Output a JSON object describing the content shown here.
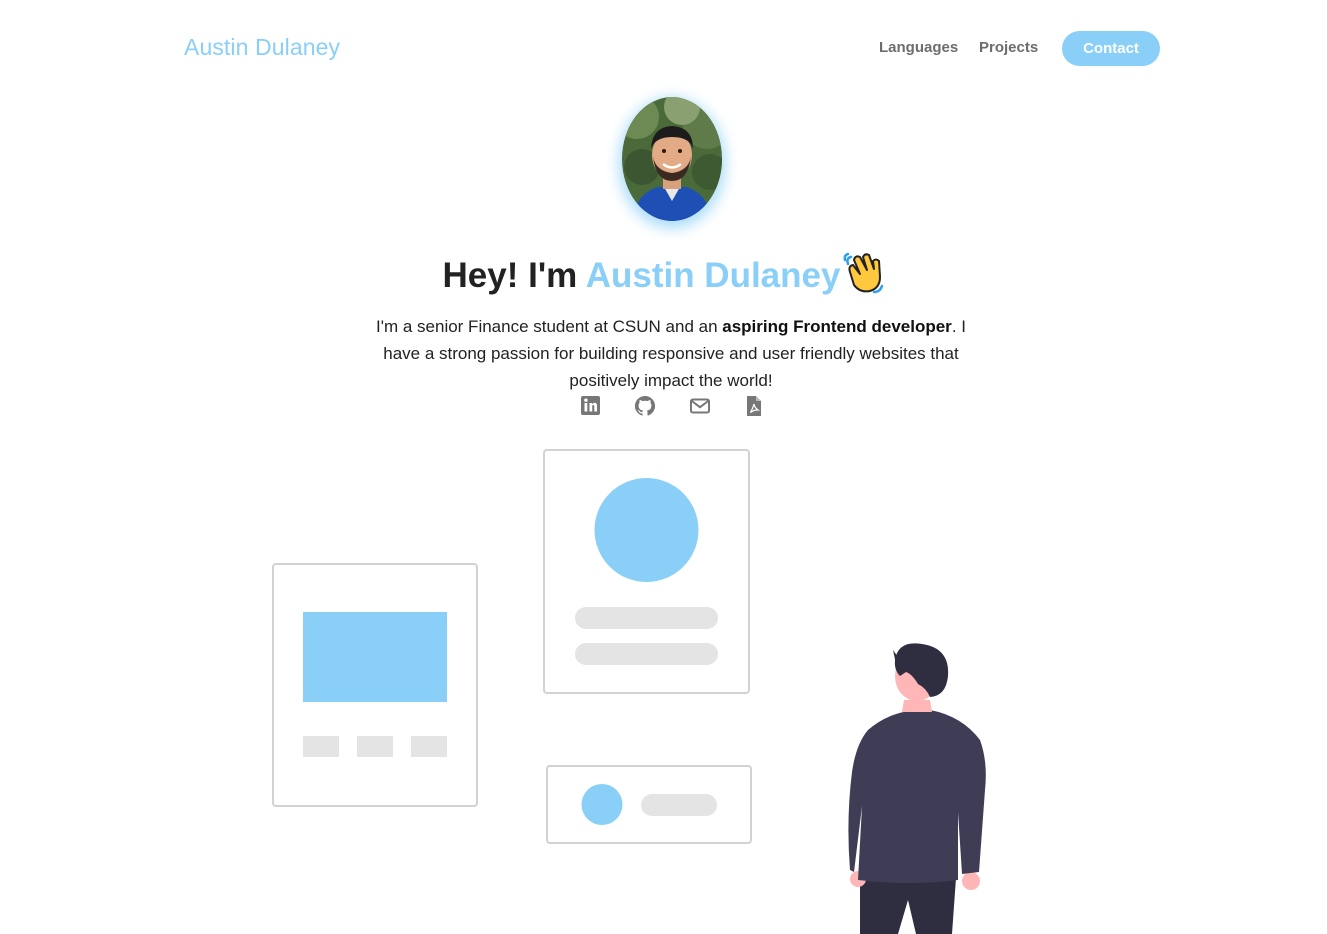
{
  "nav": {
    "brand": "Austin Dulaney",
    "links": [
      {
        "label": "Languages"
      },
      {
        "label": "Projects"
      }
    ],
    "contact_label": "Contact"
  },
  "hero": {
    "avatar_icon": "profile-photo",
    "title_prefix": "Hey! I'm ",
    "title_name": "Austin Dulaney",
    "title_emoji": "waving-hand-icon",
    "bio_part1": "I'm a senior Finance student at CSUN and an ",
    "bio_bold": "aspiring Frontend developer",
    "bio_part2": ". I have a strong passion for building responsive and user friendly websites that positively impact the world!"
  },
  "socials": [
    {
      "icon": "linkedin-icon"
    },
    {
      "icon": "github-icon"
    },
    {
      "icon": "envelope-icon"
    },
    {
      "icon": "pdf-file-icon"
    }
  ],
  "colors": {
    "accent": "#89cff7",
    "text": "#222222",
    "nav_text": "#6d6d6d",
    "icon_gray": "#777777",
    "card_border": "#d2d2d2",
    "placeholder_gray": "#e4e4e4",
    "person_suit": "#3f3d56"
  }
}
